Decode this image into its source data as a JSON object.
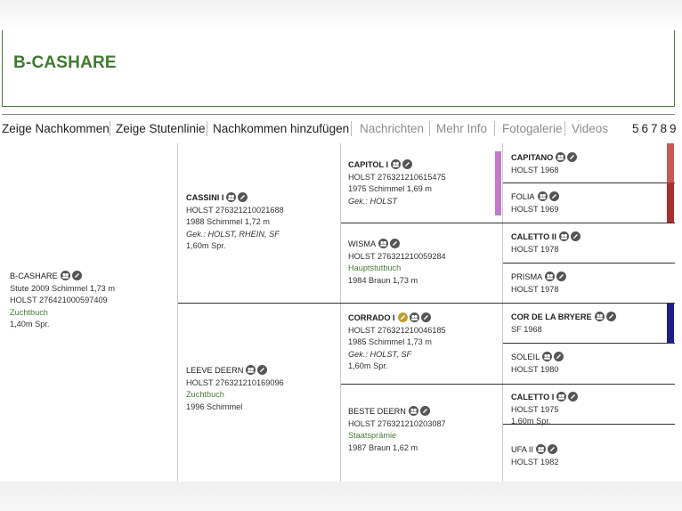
{
  "page": {
    "title": "B-CASHARE"
  },
  "nav": {
    "items": [
      {
        "label": "Zeige Nachkommen",
        "style": "active"
      },
      {
        "label": "Zeige Stutenlinie",
        "style": "active"
      },
      {
        "label": "Nachkommen hinzufügen",
        "style": "active"
      },
      {
        "label": "Nachrichten",
        "style": "muted"
      },
      {
        "label": "Mehr Info",
        "style": "muted"
      },
      {
        "label": "Fotogalerie",
        "style": "muted"
      },
      {
        "label": "Videos",
        "style": "muted"
      }
    ],
    "pages": "56789"
  },
  "colors": {
    "green": "#3f7a2e",
    "purple": "#c07ac8",
    "red": "#b33a34",
    "navy": "#1c1f86"
  },
  "pedigree": {
    "root": {
      "name": "B-CASHARE",
      "line1": "Stute 2009 Schimmel 1,73 m",
      "line2": "HOLST 276421000597409",
      "status": "Zuchtbuch",
      "perf": "1,40m Spr."
    },
    "sire": {
      "name": "CASSINI I",
      "line1": "HOLST 276321210021688",
      "line2": "1988 Schimmel 1,72 m",
      "gek": "Gek.: HOLST, RHEIN, SF",
      "perf": "1,60m Spr."
    },
    "dam": {
      "name": "LEEVE DEERN",
      "line1": "HOLST 276321210169096",
      "status": "Zuchtbuch",
      "line2": "1996 Schimmel"
    },
    "ss": {
      "name": "CAPITOL I",
      "line1": "HOLST 276321210615475",
      "line2": "1975 Schimmel 1,69 m",
      "gek": "Gek.: HOLST"
    },
    "sd": {
      "name": "WISMA",
      "line1": "HOLST 276321210059284",
      "status": "Hauptstutbuch",
      "line2": "1984 Braun 1,73 m"
    },
    "ds": {
      "name": "CORRADO I",
      "line1": "HOLST 276321210046185",
      "line2": "1985 Schimmel 1,73 m",
      "gek": "Gek.: HOLST, SF",
      "perf": "1,60m Spr."
    },
    "dd": {
      "name": "BESTE DEERN",
      "line1": "HOLST 276321210203087",
      "status": "Staatsprämie",
      "line2": "1987 Braun 1,62 m"
    },
    "sss": {
      "name": "CAPITANO",
      "line1": "HOLST 1968"
    },
    "ssd": {
      "name": "FOLIA",
      "line1": "HOLST 1969"
    },
    "sds": {
      "name": "CALETTO II",
      "line1": "HOLST 1978"
    },
    "sdd": {
      "name": "PRISMA",
      "line1": "HOLST 1978"
    },
    "dss": {
      "name": "COR DE LA BRYERE",
      "line1": "SF 1968"
    },
    "dsd": {
      "name": "SOLEIL",
      "line1": "HOLST 1980"
    },
    "dds": {
      "name": "CALETTO I",
      "line1": "HOLST 1975",
      "perf": "1,60m Spr."
    },
    "ddd": {
      "name": "UFA II",
      "line1": "HOLST 1982"
    }
  }
}
